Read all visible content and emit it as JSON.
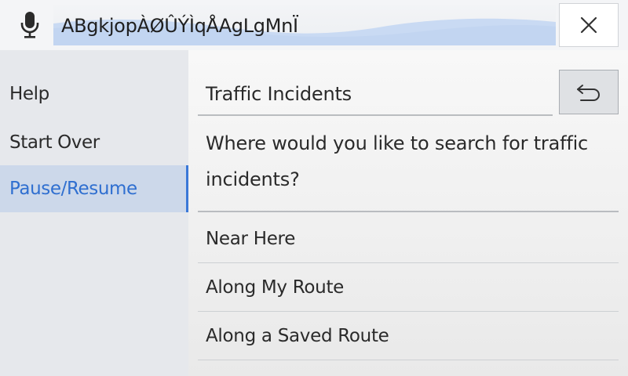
{
  "speech": {
    "recognized_text": "ABgkjopÀØÛÝÌqÅAgLgMnÏ"
  },
  "icons": {
    "mic": "microphone-icon",
    "close": "close-icon",
    "back": "back-arrow-icon"
  },
  "colors": {
    "accent": "#2f6fd0",
    "active_bg": "#ccd8ea",
    "wave": "#c9daf3"
  },
  "sidebar": {
    "items": [
      {
        "label": "Help"
      },
      {
        "label": "Start Over"
      },
      {
        "label": "Pause/Resume"
      }
    ]
  },
  "panel": {
    "title": "Traffic Incidents",
    "prompt": "Where would you like to search for traffic incidents?",
    "options": [
      {
        "label": "Near Here"
      },
      {
        "label": "Along My Route"
      },
      {
        "label": "Along a Saved Route"
      }
    ]
  }
}
